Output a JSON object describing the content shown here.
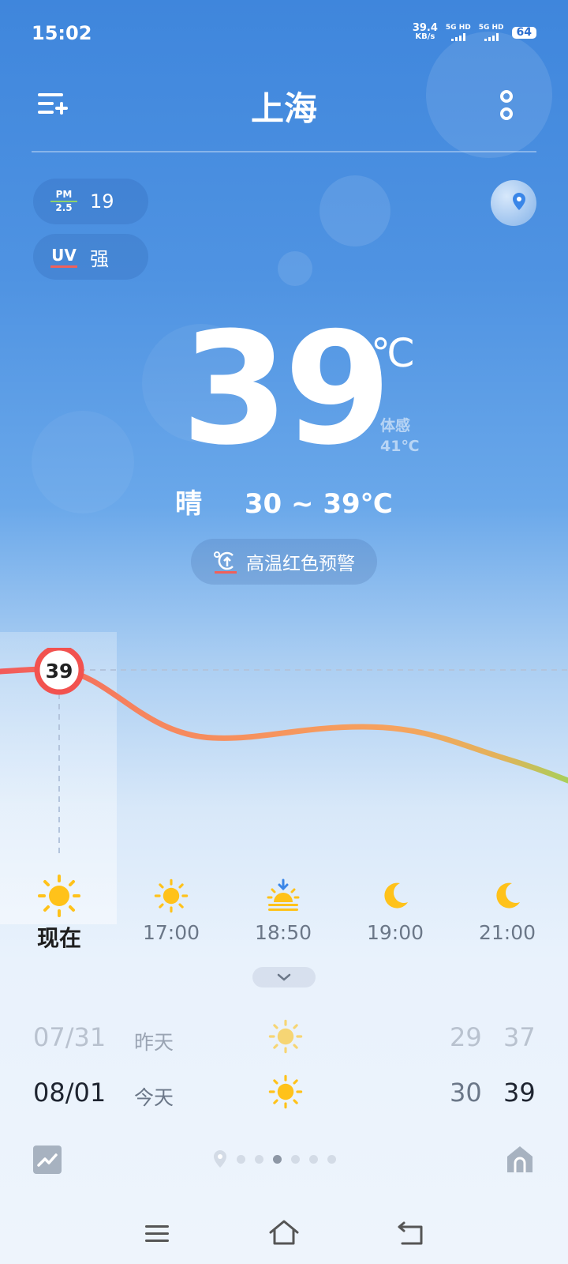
{
  "status": {
    "time": "15:02",
    "net_speed_value": "39.4",
    "net_speed_unit": "KB/s",
    "sim1": "5G HD",
    "sim2": "5G HD",
    "battery": "64"
  },
  "header": {
    "city": "上海"
  },
  "air": {
    "pm_top": "PM",
    "pm_bottom": "2.5",
    "pm_value": "19",
    "uv_label": "UV",
    "uv_value": "强"
  },
  "current": {
    "temp": "39",
    "unit": "℃",
    "feels_label": "体感",
    "feels_value": "41℃",
    "condition": "晴",
    "range": "30 ~ 39℃"
  },
  "alert": {
    "text": "高温红色预警"
  },
  "chart_data": {
    "type": "line",
    "x": [
      "现在",
      "17:00",
      "18:50",
      "19:00",
      "21:00"
    ],
    "values": [
      39,
      null,
      null,
      null,
      null
    ],
    "highlight_label": "39"
  },
  "hourly": [
    {
      "label": "现在",
      "icon": "sun-icon"
    },
    {
      "label": "17:00",
      "icon": "sun-icon"
    },
    {
      "label": "18:50",
      "icon": "sunset-icon"
    },
    {
      "label": "19:00",
      "icon": "moon-icon"
    },
    {
      "label": "21:00",
      "icon": "moon-icon"
    }
  ],
  "daily": [
    {
      "date": "07/31",
      "name": "昨天",
      "icon": "sun-icon",
      "low": "29",
      "high": "37"
    },
    {
      "date": "08/01",
      "name": "今天",
      "icon": "sun-icon",
      "low": "30",
      "high": "39"
    }
  ],
  "colors": {
    "sky_top": "#3f86dc",
    "sun": "#ffc21a",
    "curve_hot": "#f25a5a",
    "curve_warm": "#f6a35e",
    "curve_cool": "#a8cf5a"
  }
}
